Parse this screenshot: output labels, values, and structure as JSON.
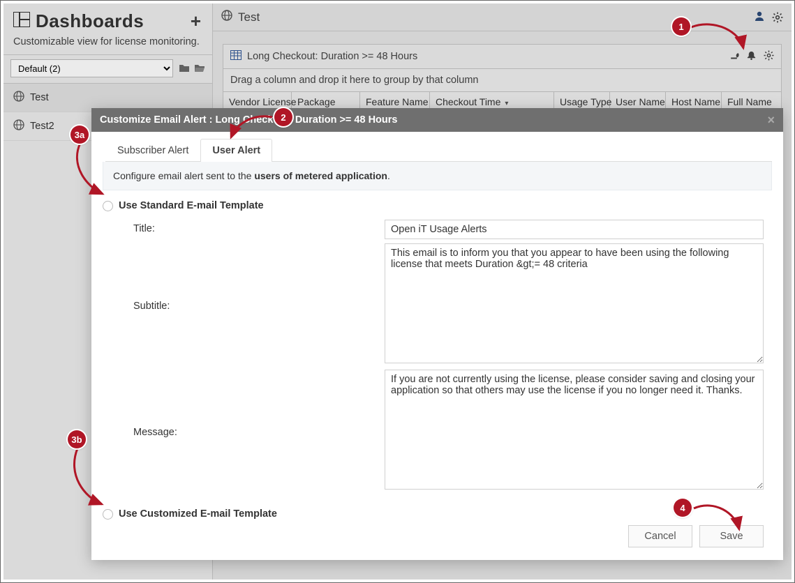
{
  "sidebar": {
    "title": "Dashboards",
    "subtitle": "Customizable view for license monitoring.",
    "select_value": "Default (2)",
    "items": [
      {
        "label": "Test"
      },
      {
        "label": "Test2"
      }
    ]
  },
  "header": {
    "title": "Test"
  },
  "panel": {
    "title": "Long Checkout: Duration >= 48 Hours",
    "group_hint": "Drag a column and drop it here to group by that column",
    "columns": [
      "Vendor License",
      "Package",
      "Feature Name",
      "Checkout Time",
      "Usage Type",
      "User Name",
      "Host Name",
      "Full Name"
    ]
  },
  "modal": {
    "title": "Customize Email Alert : Long Checkout: Duration >= 48 Hours",
    "tabs": {
      "subscriber": "Subscriber Alert",
      "user": "User Alert"
    },
    "info_prefix": "Configure email alert sent to the ",
    "info_bold": "users of metered application",
    "radio_standard": "Use Standard E-mail Template",
    "radio_custom": "Use Customized E-mail Template",
    "labels": {
      "title": "Title:",
      "subtitle": "Subtitle:",
      "message": "Message:"
    },
    "fields": {
      "title": "Open iT Usage Alerts",
      "subtitle": "This email is to inform you that you appear to have been using the following license that meets Duration &gt;= 48 criteria",
      "message": "If you are not currently using the license, please consider saving and closing your application so that others may use the license if you no longer need it. Thanks."
    },
    "buttons": {
      "cancel": "Cancel",
      "save": "Save"
    }
  },
  "annotations": {
    "b1": "1",
    "b2": "2",
    "b3a": "3a",
    "b3b": "3b",
    "b4": "4"
  }
}
